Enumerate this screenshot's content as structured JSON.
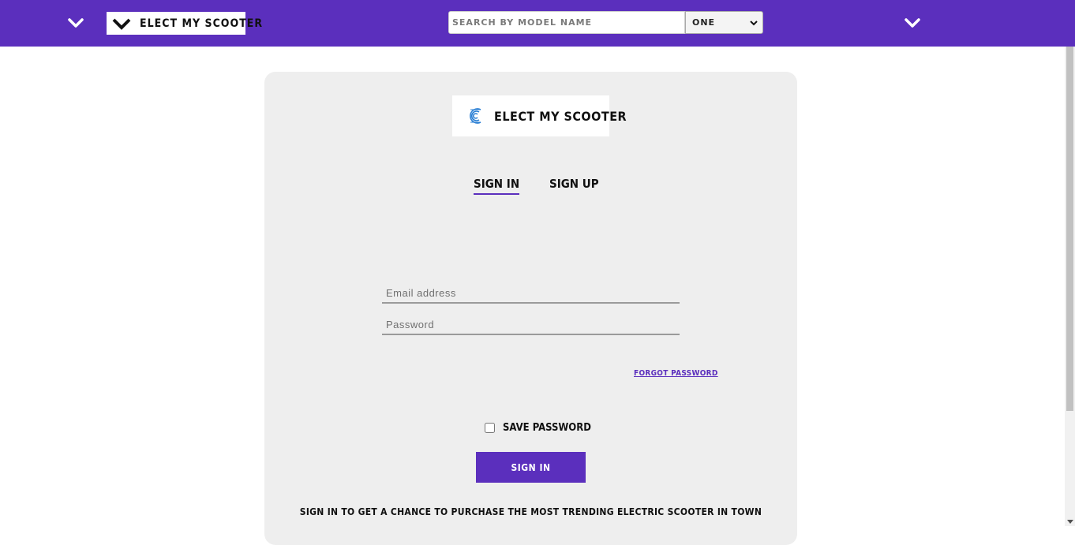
{
  "header": {
    "brand": "ELECT MY SCOOTER",
    "search": {
      "placeholder": "SEARCH BY MODEL NAME",
      "value": ""
    },
    "select": {
      "selected": "ONE"
    },
    "colors": {
      "bar": "#5b2fbd",
      "logo_bg": "#ffffff"
    },
    "icons": {
      "left_menu": "chevron-down-icon",
      "right_menu": "chevron-down-icon"
    }
  },
  "card": {
    "logo_name": "ELECT MY SCOOTER",
    "logo_icon": "scooter-logo-icon",
    "tabs": [
      {
        "label": "SIGN IN",
        "active": true
      },
      {
        "label": "SIGN UP",
        "active": false
      }
    ],
    "email": {
      "placeholder": "Email address",
      "value": ""
    },
    "password": {
      "placeholder": "Password",
      "value": ""
    },
    "forgot_label": "FORGOT PASSWORD",
    "save_password_label": "SAVE PASSWORD",
    "save_password_checked": false,
    "signin_button": "SIGN IN",
    "promo_text": "SIGN IN TO GET A CHANCE TO PURCHASE THE MOST TRENDING ELECTRIC SCOOTER IN TOWN",
    "colors": {
      "card_bg": "#eeeeee",
      "accent": "#5b2fbd"
    }
  }
}
